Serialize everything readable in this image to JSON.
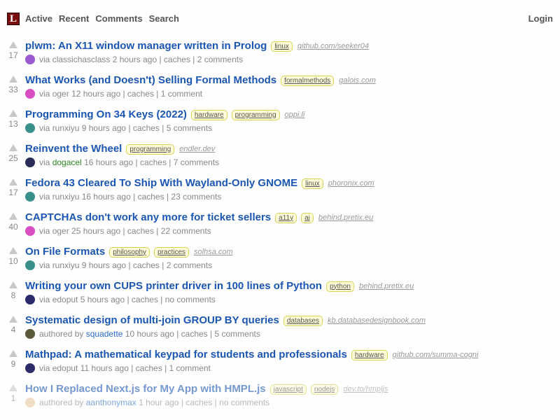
{
  "header": {
    "logo_letter": "L",
    "nav": [
      "Active",
      "Recent",
      "Comments",
      "Search"
    ],
    "login": "Login"
  },
  "stories": [
    {
      "score": "17",
      "title": "plwm: An X11 window manager written in Prolog",
      "tags": [
        "linux"
      ],
      "domain": "github.com/seeker04",
      "prefix": "via",
      "user": "classichasclass",
      "time": "2 hours ago",
      "caches": "caches",
      "comments": "2 comments",
      "avatar_color": "#9b59d0"
    },
    {
      "score": "33",
      "title": "What Works (and Doesn't) Selling Formal Methods",
      "tags": [
        "formalmethods"
      ],
      "domain": "galois.com",
      "prefix": "via",
      "user": "oger",
      "time": "12 hours ago",
      "caches": "caches",
      "comments": "1 comment",
      "avatar_color": "#d94fc1"
    },
    {
      "score": "13",
      "title": "Programming On 34 Keys (2022)",
      "tags": [
        "hardware",
        "programming"
      ],
      "domain": "oppi.li",
      "prefix": "via",
      "user": "runxiyu",
      "time": "9 hours ago",
      "caches": "caches",
      "comments": "5 comments",
      "avatar_color": "#3a8f8a"
    },
    {
      "score": "25",
      "title": "Reinvent the Wheel",
      "tags": [
        "programming"
      ],
      "domain": "endler.dev",
      "prefix": "via",
      "user": "dogacel",
      "time": "16 hours ago",
      "caches": "caches",
      "comments": "7 comments",
      "avatar_color": "#2b2b5a"
    },
    {
      "score": "17",
      "title": "Fedora 43 Cleared To Ship With Wayland-Only GNOME",
      "tags": [
        "linux"
      ],
      "domain": "phoronix.com",
      "prefix": "via",
      "user": "runxiyu",
      "time": "16 hours ago",
      "caches": "caches",
      "comments": "23 comments",
      "avatar_color": "#3a8f8a"
    },
    {
      "score": "40",
      "title": "CAPTCHAs don't work any more for ticket sellers",
      "tags": [
        "a11y",
        "ai"
      ],
      "domain": "behind.pretix.eu",
      "prefix": "via",
      "user": "oger",
      "time": "25 hours ago",
      "caches": "caches",
      "comments": "22 comments",
      "avatar_color": "#d94fc1"
    },
    {
      "score": "10",
      "title": "On File Formats",
      "tags": [
        "philosophy",
        "practices"
      ],
      "domain": "solhsa.com",
      "prefix": "via",
      "user": "runxiyu",
      "time": "9 hours ago",
      "caches": "caches",
      "comments": "2 comments",
      "avatar_color": "#3a8f8a"
    },
    {
      "score": "8",
      "title": "Writing your own CUPS printer driver in 100 lines of Python",
      "tags": [
        "python"
      ],
      "domain": "behind.pretix.eu",
      "prefix": "via",
      "user": "edoput",
      "time": "5 hours ago",
      "caches": "caches",
      "comments": "no comments",
      "avatar_color": "#2b2b6a"
    },
    {
      "score": "4",
      "title": "Systematic design of multi-join GROUP BY queries",
      "tags": [
        "databases"
      ],
      "domain": "kb.databasedesignbook.com",
      "prefix": "authored by",
      "user": "squadette",
      "time": "10 hours ago",
      "caches": "caches",
      "comments": "5 comments",
      "avatar_color": "#5a5a3a"
    },
    {
      "score": "9",
      "title": "Mathpad: A mathematical keypad for students and professionals",
      "tags": [
        "hardware"
      ],
      "domain": "github.com/summa-cogni",
      "prefix": "via",
      "user": "edoput",
      "time": "11 hours ago",
      "caches": "caches",
      "comments": "1 comment",
      "avatar_color": "#2b2b6a"
    },
    {
      "score": "1",
      "title": "How I Replaced Next.js for My App with HMPL.js",
      "tags": [
        "javascript",
        "nodejs"
      ],
      "domain": "dev.to/hmpljs",
      "prefix": "authored by",
      "user": "aanthonymax",
      "time": "1 hour ago",
      "caches": "caches",
      "comments": "no comments",
      "avatar_color": "#e8c8a0"
    }
  ]
}
